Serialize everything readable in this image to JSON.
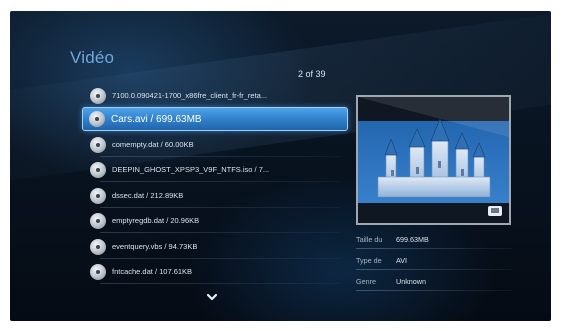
{
  "screen": {
    "title": "Vidéo",
    "counter": "2 of 39"
  },
  "list": {
    "items": [
      {
        "label": "7100.0.090421-1700_x86fre_client_fr-fr_reta...",
        "icon": "video-disc-icon",
        "selected": false
      },
      {
        "label": "Cars.avi / 699.63MB",
        "icon": "video-disc-icon",
        "selected": true
      },
      {
        "label": "comempty.dat / 60.00KB",
        "icon": "video-disc-icon",
        "selected": false
      },
      {
        "label": "DEEPIN_GHOST_XPSP3_V9F_NTFS.iso / 7...",
        "icon": "video-disc-icon",
        "selected": false
      },
      {
        "label": "dssec.dat / 212.89KB",
        "icon": "video-disc-icon",
        "selected": false
      },
      {
        "label": "emptyregdb.dat / 20.96KB",
        "icon": "video-disc-icon",
        "selected": false
      },
      {
        "label": "eventquery.vbs / 94.73KB",
        "icon": "video-disc-icon",
        "selected": false
      },
      {
        "label": "fntcache.dat / 107.61KB",
        "icon": "video-disc-icon",
        "selected": false
      }
    ],
    "more_icon": "chevron-down-icon"
  },
  "details": {
    "size_label": "Taille du",
    "size_value": "699.63MB",
    "type_label": "Type de",
    "type_value": "AVI",
    "genre_label": "Genre",
    "genre_value": "Unknown"
  },
  "colors": {
    "accent": "#3a8fe0",
    "title": "#6fa7dc",
    "preview_bg": "#2f6fb6"
  }
}
